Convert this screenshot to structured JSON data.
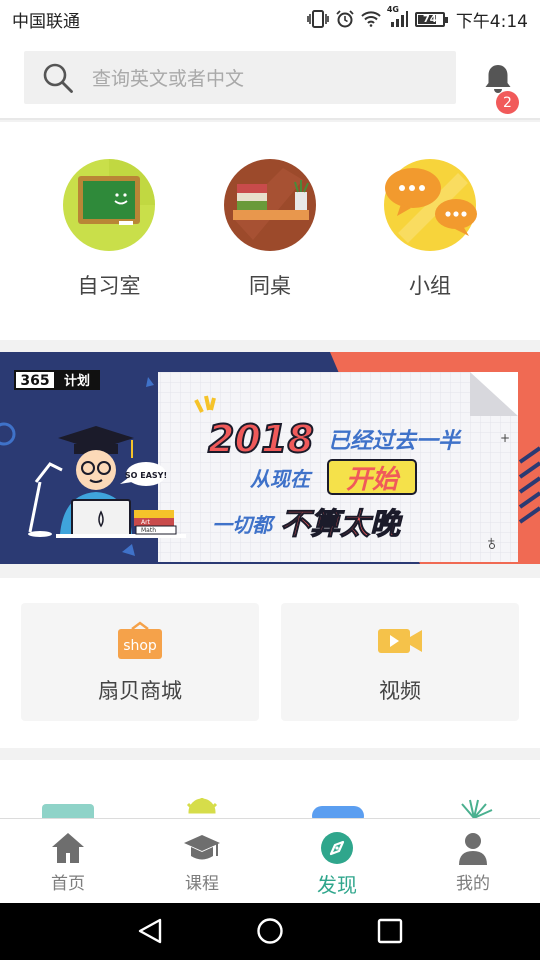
{
  "status_bar": {
    "carrier": "中国联通",
    "network_label": "4G",
    "battery_level": "74",
    "time": "下午4:14"
  },
  "search": {
    "placeholder": "查询英文或者中文"
  },
  "notifications": {
    "badge_count": "2"
  },
  "features": [
    {
      "label": "自习室",
      "icon": "chalkboard-icon"
    },
    {
      "label": "同桌",
      "icon": "bookshelf-icon"
    },
    {
      "label": "小组",
      "icon": "chat-bubbles-icon"
    }
  ],
  "banner": {
    "tag_number": "365",
    "tag_text": "计划",
    "bubble_text": "SO EASY!",
    "headline_year": "2018",
    "headline_part1": "已经过去一半",
    "headline_line2_a": "从现在",
    "headline_line2_b": "开始",
    "headline_line3_a": "一切都",
    "headline_line3_b": "不算太晚",
    "book_label_1": "Art",
    "book_label_2": "Math"
  },
  "cards": [
    {
      "label": "扇贝商城",
      "icon": "shop-icon",
      "icon_text": "shop"
    },
    {
      "label": "视频",
      "icon": "video-camera-icon"
    }
  ],
  "bottom_nav": [
    {
      "label": "首页",
      "icon": "home-icon",
      "active": false
    },
    {
      "label": "课程",
      "icon": "graduation-cap-icon",
      "active": false
    },
    {
      "label": "发现",
      "icon": "compass-icon",
      "active": true
    },
    {
      "label": "我的",
      "icon": "person-icon",
      "active": false
    }
  ],
  "colors": {
    "accent": "#2fa68c",
    "badge": "#f15a5a",
    "banner_navy": "#2b3a73",
    "banner_coral": "#f06a53"
  }
}
